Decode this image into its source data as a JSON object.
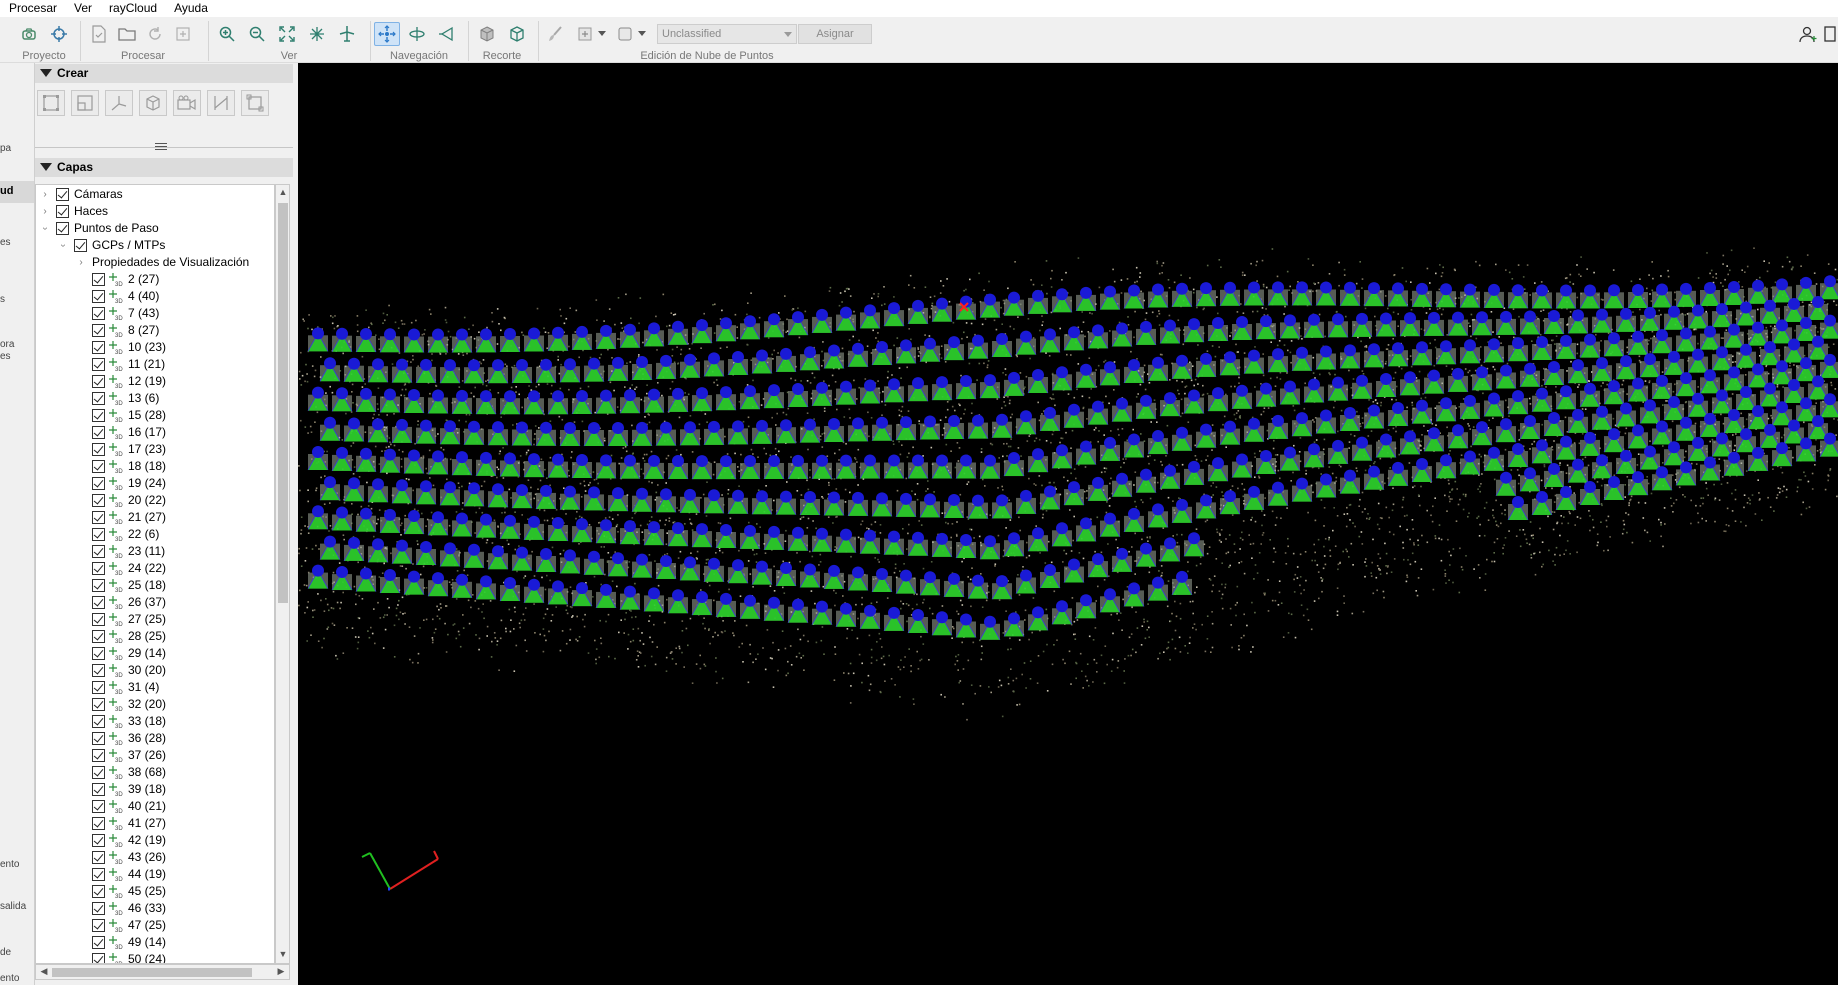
{
  "menu": [
    "Procesar",
    "Ver",
    "rayCloud",
    "Ayuda"
  ],
  "toolbar": {
    "groups": {
      "proyecto": "Proyecto",
      "procesar": "Procesar",
      "ver": "Ver",
      "navegacion": "Navegación",
      "recorte": "Recorte",
      "edicion": "Edición de Nube de Puntos"
    },
    "class_select": "Unclassified",
    "assign_label": "Asignar"
  },
  "left_strip": {
    "labels": [
      "pa",
      "ud",
      "es",
      "s",
      "ora",
      "es",
      "ento",
      "salida",
      "de",
      "ento"
    ]
  },
  "panel": {
    "crear_title": "Crear",
    "capas_title": "Capas"
  },
  "layers": {
    "camaras": "Cámaras",
    "haces": "Haces",
    "puntos_de_paso": "Puntos de Paso",
    "gcps_mtps": "GCPs / MTPs",
    "propiedades": "Propiedades de Visualización",
    "points": [
      "2 (27)",
      "4 (40)",
      "7 (43)",
      "8 (27)",
      "10 (23)",
      "11 (21)",
      "12 (19)",
      "13 (6)",
      "15 (28)",
      "16 (17)",
      "17 (23)",
      "18 (18)",
      "19 (24)",
      "20 (22)",
      "21 (27)",
      "22 (6)",
      "23 (11)",
      "24 (22)",
      "25 (18)",
      "26 (37)",
      "27 (25)",
      "28 (25)",
      "29 (14)",
      "30 (20)",
      "31 (4)",
      "32 (20)",
      "33 (18)",
      "36 (28)",
      "37 (26)",
      "38 (68)",
      "39 (18)",
      "40 (21)",
      "41 (27)",
      "42 (19)",
      "43 (26)",
      "44 (19)",
      "45 (25)",
      "46 (33)",
      "47 (25)",
      "49 (14)",
      "50 (24)"
    ]
  },
  "colors": {
    "camera_blue": "#1a1ad6",
    "frustum_green": "#22d322",
    "viewport_bg": "#000000",
    "axis_x": "#e02020",
    "axis_y": "#20c020",
    "axis_z": "#2040ff"
  }
}
